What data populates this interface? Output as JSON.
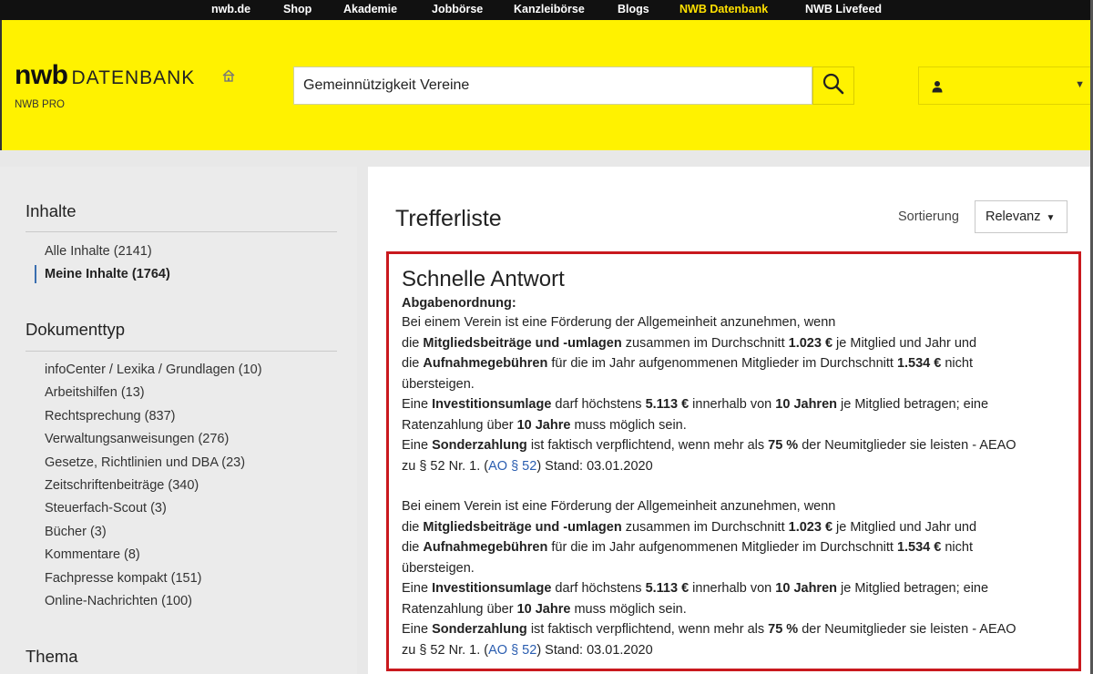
{
  "topnav": {
    "items": [
      {
        "label": "nwb.de",
        "active": false
      },
      {
        "label": "Shop",
        "active": false
      },
      {
        "label": "Akademie",
        "active": false
      },
      {
        "label": "Jobbörse",
        "active": false
      },
      {
        "label": "Kanzleibörse",
        "active": false
      },
      {
        "label": "Blogs",
        "active": false
      },
      {
        "label": "NWB Datenbank",
        "active": true
      },
      {
        "label": "NWB Livefeed",
        "active": false
      }
    ]
  },
  "header": {
    "logo_main": "nwb",
    "logo_sub": "DATENBANK",
    "edition": "NWB PRO",
    "search_value": "Gemeinnützigkeit Vereine",
    "icons": {
      "home": "home-icon",
      "search": "search-icon",
      "user": "user-icon",
      "dropdown": "caret-down-icon"
    }
  },
  "sidebar": {
    "inhalte_heading": "Inhalte",
    "inhalte": [
      {
        "label": "Alle Inhalte (2141)",
        "active": false
      },
      {
        "label": "Meine Inhalte (1764)",
        "active": true
      }
    ],
    "dokumenttyp_heading": "Dokumenttyp",
    "dokumenttyp": [
      "infoCenter / Lexika / Grundlagen (10)",
      "Arbeitshilfen (13)",
      "Rechtsprechung (837)",
      "Verwaltungsanweisungen (276)",
      "Gesetze, Richtlinien und DBA (23)",
      "Zeitschriftenbeiträge (340)",
      "Steuerfach-Scout (3)",
      "Bücher (3)",
      "Kommentare (8)",
      "Fachpresse kompakt (151)",
      "Online-Nachrichten (100)"
    ],
    "thema_heading": "Thema"
  },
  "main": {
    "title": "Trefferliste",
    "sort_label": "Sortierung",
    "sort_value": "Relevanz",
    "answer": {
      "title": "Schnelle Antwort",
      "subtitle": "Abgabenordnung:",
      "blocks": [
        {
          "l1": "Bei einem Verein ist eine Förderung der Allgemeinheit anzunehmen, wenn",
          "l2a": "die ",
          "l2b": "Mitgliedsbeiträge und -umlagen",
          "l2c": " zusammen im Durchschnitt ",
          "l2d": "1.023 €",
          "l2e": " je Mitglied und Jahr und",
          "l3a": "die ",
          "l3b": "Aufnahmegebühren",
          "l3c": " für die im Jahr aufgenommenen Mitglieder im Durchschnitt ",
          "l3d": "1.534 €",
          "l3e": " nicht",
          "l4": "übersteigen.",
          "l5a": "Eine ",
          "l5b": "Investitionsumlage",
          "l5c": " darf höchstens ",
          "l5d": "5.113 €",
          "l5e": " innerhalb von ",
          "l5f": "10 Jahren",
          "l5g": " je Mitglied betragen; eine",
          "l6a": "Ratenzahlung über ",
          "l6b": "10 Jahre",
          "l6c": " muss möglich sein.",
          "l7a": "Eine ",
          "l7b": "Sonderzahlung",
          "l7c": " ist faktisch verpflichtend, wenn mehr als ",
          "l7d": "75 %",
          "l7e": " der Neumitglieder sie leisten - AEAO",
          "l8a": "zu § 52 Nr. 1. (",
          "l8b": "AO § 52",
          "l8c": ") Stand: 03.01.2020"
        },
        {
          "l1": "Bei einem Verein ist eine Förderung der Allgemeinheit anzunehmen, wenn",
          "l2a": "die ",
          "l2b": "Mitgliedsbeiträge und -umlagen",
          "l2c": " zusammen im Durchschnitt ",
          "l2d": "1.023 €",
          "l2e": " je Mitglied und Jahr und",
          "l3a": "die ",
          "l3b": "Aufnahmegebühren",
          "l3c": " für die im Jahr aufgenommenen Mitglieder im Durchschnitt ",
          "l3d": "1.534 €",
          "l3e": " nicht",
          "l4": "übersteigen.",
          "l5a": "Eine ",
          "l5b": "Investitionsumlage",
          "l5c": " darf höchstens ",
          "l5d": "5.113 €",
          "l5e": " innerhalb von ",
          "l5f": "10 Jahren",
          "l5g": " je Mitglied betragen; eine",
          "l6a": "Ratenzahlung über ",
          "l6b": "10 Jahre",
          "l6c": " muss möglich sein.",
          "l7a": "Eine ",
          "l7b": "Sonderzahlung",
          "l7c": " ist faktisch verpflichtend, wenn mehr als ",
          "l7d": "75 %",
          "l7e": " der Neumitglieder sie leisten - AEAO",
          "l8a": "zu § 52 Nr. 1. (",
          "l8b": "AO § 52",
          "l8c": ") Stand: 03.01.2020"
        }
      ]
    }
  },
  "colors": {
    "accent_yellow": "#fff200",
    "highlight_red": "#c9191e",
    "link_blue": "#2a5db0",
    "nav_active": "#ffe100"
  }
}
